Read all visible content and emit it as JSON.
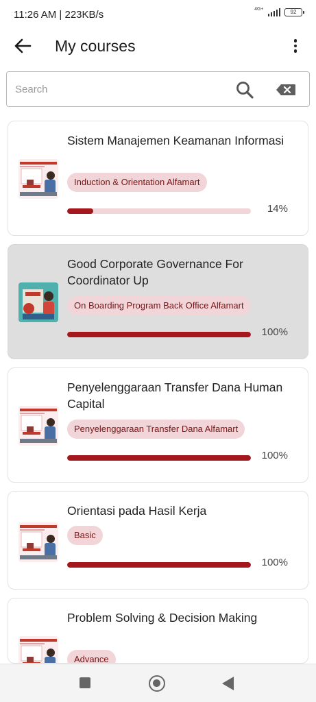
{
  "status_bar": {
    "time": "11:26 AM | 223KB/s",
    "network": "4G+",
    "battery": "92"
  },
  "header": {
    "title": "My courses"
  },
  "search": {
    "placeholder": "Search",
    "value": ""
  },
  "courses": [
    {
      "title": "Sistem Manajemen Keamanan Informasi",
      "tag": "Induction & Orientation Alfamart",
      "progress": 14,
      "progress_label": "14%",
      "selected": false
    },
    {
      "title": "Good Corporate Governance For Coordinator Up",
      "tag": "On Boarding Program Back Office Alfamart",
      "progress": 100,
      "progress_label": "100%",
      "selected": true
    },
    {
      "title": "Penyelenggaraan Transfer Dana Human Capital",
      "tag": "Penyelenggaraan Transfer Dana Alfamart",
      "progress": 100,
      "progress_label": "100%",
      "selected": false
    },
    {
      "title": "Orientasi pada Hasil Kerja",
      "tag": "Basic",
      "progress": 100,
      "progress_label": "100%",
      "selected": false
    },
    {
      "title": "Problem Solving & Decision Making",
      "tag": "Advance",
      "progress": null,
      "progress_label": "",
      "selected": false
    }
  ],
  "colors": {
    "accent": "#a4171d",
    "tag_bg": "#f1d5d8",
    "tag_text": "#7b1414",
    "selected_card": "#dedede"
  }
}
